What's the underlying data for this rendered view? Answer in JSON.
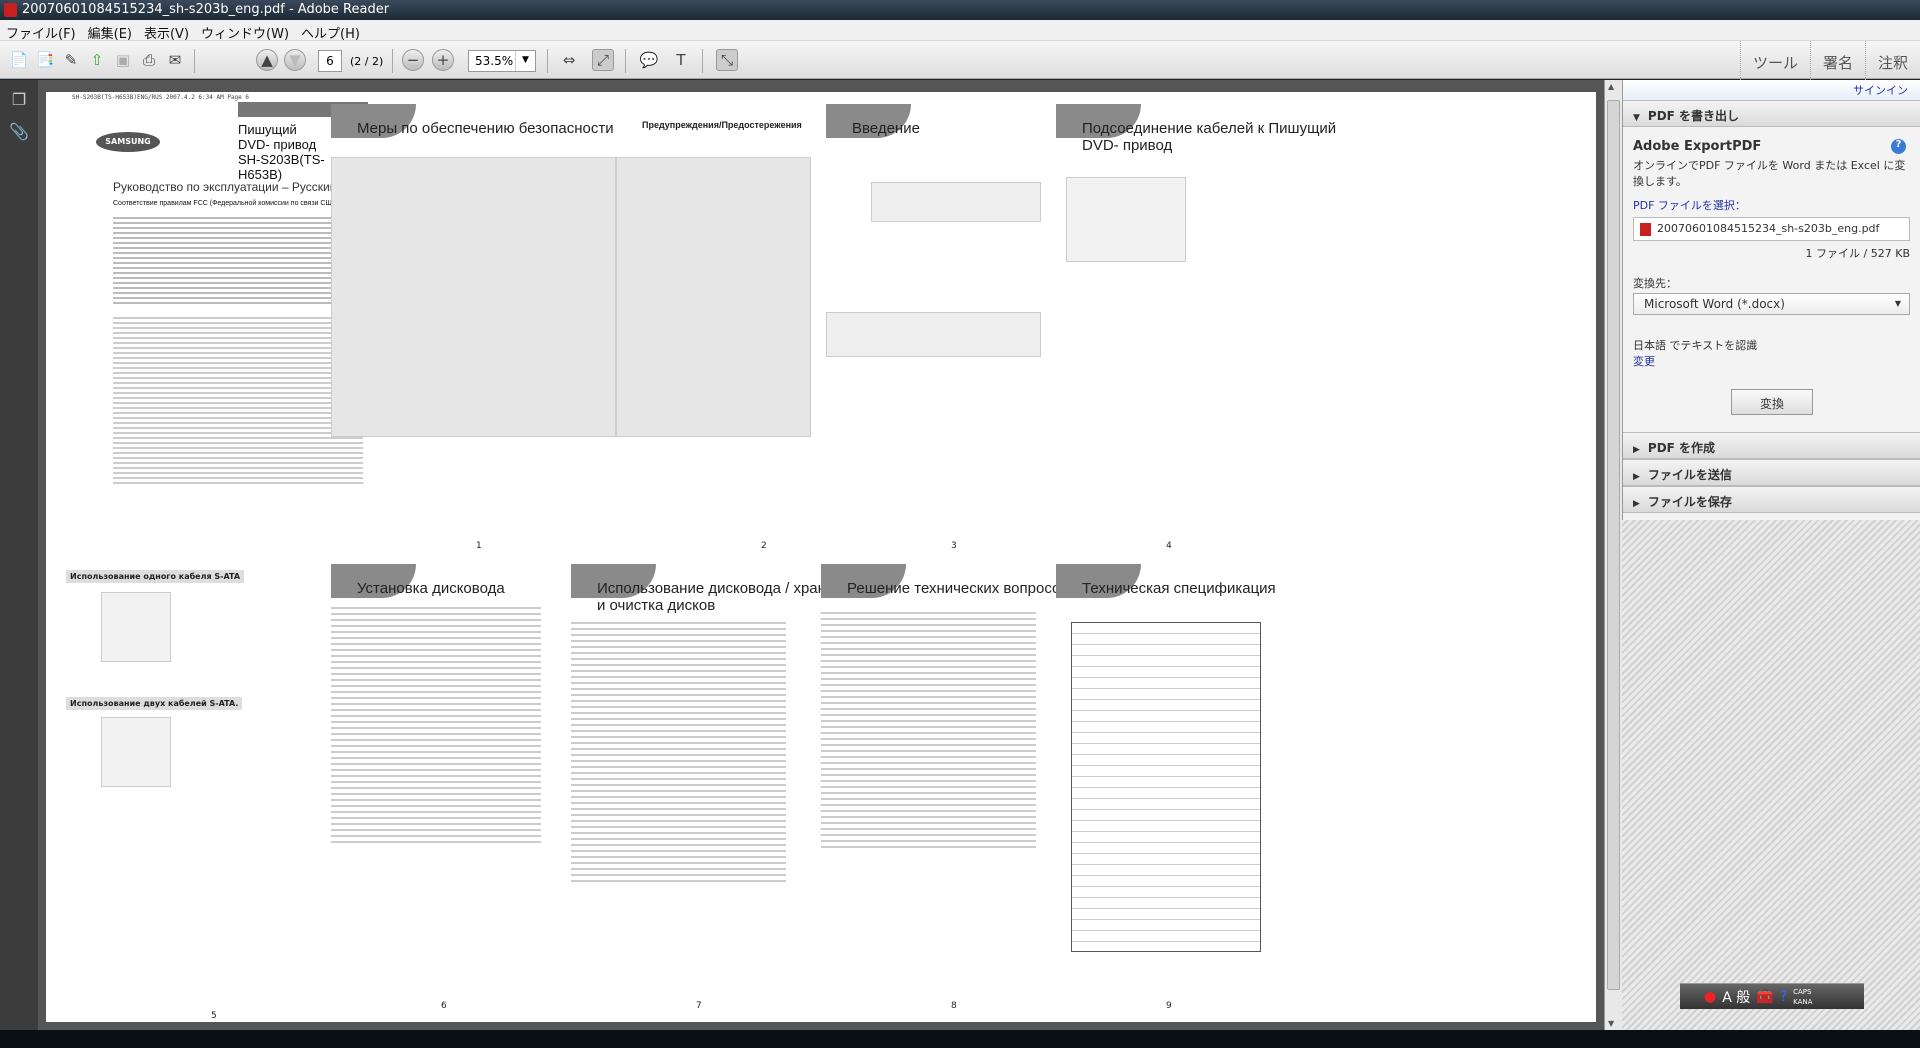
{
  "window": {
    "title": "20070601084515234_sh-s203b_eng.pdf - Adobe Reader"
  },
  "menu": [
    "ファイル(F)",
    "編集(E)",
    "表示(V)",
    "ウィンドウ(W)",
    "ヘルプ(H)"
  ],
  "toolbar": {
    "page_number": "6",
    "page_count": "(2 / 2)",
    "zoom": "53.5%"
  },
  "tabs": [
    "ツール",
    "署名",
    "注釈"
  ],
  "panel": {
    "signin": "サインイン",
    "export_section": "PDF を書き出し",
    "export_title": "Adobe ExportPDF",
    "export_desc": "オンラインでPDF ファイルを Word または Excel に変換します。",
    "select_label": "PDF ファイルを選択：",
    "file_name": "20070601084515234_sh-s203b_eng.pdf",
    "file_info": "1 ファイル / 527 KB",
    "convert_to_label": "変換先：",
    "convert_to_value": "Microsoft Word (*.docx)",
    "ocr_text": "日本語 でテキストを認識",
    "change_link": "変更",
    "convert_button": "変換",
    "sections": [
      "PDF を作成",
      "ファイルを送信",
      "ファイルを保存"
    ]
  },
  "ime": {
    "mode": "A 般",
    "caps": "CAPS",
    "kana": "KANA"
  },
  "document": {
    "header_line": "SH-S203B(TS-H653B)ENG/RUS   2007.4.2   6:34 AM   Page 6",
    "cover": {
      "brand": "SAMSUNG",
      "title1": "Пишущий",
      "title2": "DVD- привод",
      "title3": "SH-S203B(TS-H653B)",
      "subtitle": "Руководство по эксплуатации – Русский яз",
      "fcc": "Соответствие правилам FCC (Федеральной комиссии по связи США)"
    },
    "pages": [
      {
        "num": "1",
        "title": "Меры по обеспечению безопасности"
      },
      {
        "num": "2",
        "title": "Предупреждения/Предостережения"
      },
      {
        "num": "3",
        "title": "Введение"
      },
      {
        "num": "4",
        "title": "Подсоединение кабелей к Пишущий DVD- привод"
      },
      {
        "num": "5",
        "title": "Использование одного кабеля S-ATA"
      },
      {
        "num": "6",
        "title": "Установка дисковода"
      },
      {
        "num": "7",
        "title": "Использование дисковода / хранение и очистка дисков"
      },
      {
        "num": "8",
        "title": "Решение технических вопросов."
      },
      {
        "num": "9",
        "title": "Техническая спецификация"
      }
    ],
    "page5_sub2": "Использование двух кабелей S-ATA."
  }
}
